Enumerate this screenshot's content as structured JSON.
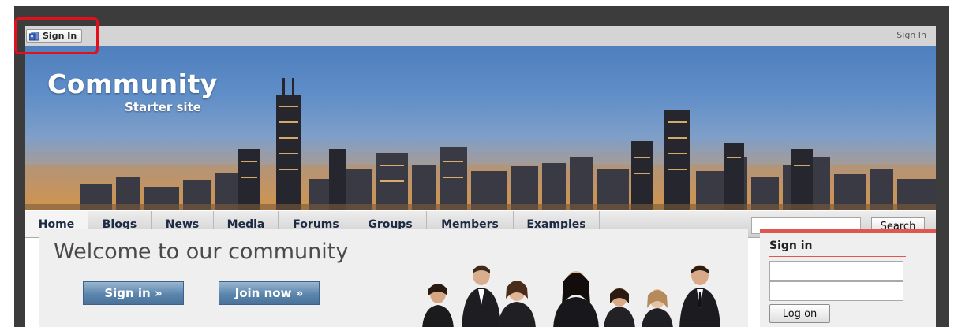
{
  "topbar": {
    "signin_chip_label": "Sign In",
    "signin_link": "Sign In"
  },
  "banner": {
    "logo_main": "Community",
    "logo_sub": "Starter site"
  },
  "nav": {
    "items": [
      {
        "label": "Home"
      },
      {
        "label": "Blogs"
      },
      {
        "label": "News"
      },
      {
        "label": "Media"
      },
      {
        "label": "Forums"
      },
      {
        "label": "Groups"
      },
      {
        "label": "Members"
      },
      {
        "label": "Examples"
      }
    ],
    "search_value": "",
    "search_button": "Search"
  },
  "welcome": {
    "title": "Welcome to our community",
    "signin_button": "Sign in »",
    "join_button": "Join now »"
  },
  "signin_box": {
    "heading": "Sign in",
    "username_value": "",
    "password_value": "",
    "logon_button": "Log on"
  },
  "colors": {
    "highlight": "#e1101a",
    "accent_red": "#e0574f",
    "nav_text": "#1d2a44",
    "cta_blue": "#5b86ad"
  },
  "icons": {
    "signin_chip": "user-signin-icon"
  }
}
